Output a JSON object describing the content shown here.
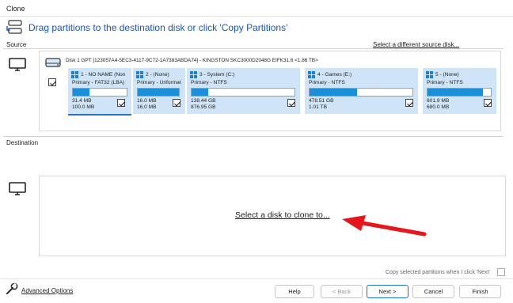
{
  "window": {
    "title": "Clone"
  },
  "heading": "Drag partitions to the destination disk or click 'Copy Partitions'",
  "source": {
    "label": "Source",
    "select_link": "Select a different source disk...",
    "disk_title": "Disk 1 GPT [123057A4-5EC3-4117-9C72-1A7383ABDA74] - KINGSTON SKC3000D2048G EIFK31.6  <1.86 TB>",
    "disk_checked": true,
    "partitions": [
      {
        "name": "1 - NO NAME (Non",
        "type": "Primary - FAT32 (LBA)",
        "used": "31.4 MB",
        "total": "100.0 MB",
        "fill": 0.31,
        "checked": true,
        "os_icon": "windows-icon"
      },
      {
        "name": "2 -  (None)",
        "type": "Primary - Unformat",
        "used": "16.0 MB",
        "total": "16.0 MB",
        "fill": 1.0,
        "checked": true,
        "os_icon": "windows-icon"
      },
      {
        "name": "3 - System (C:)",
        "type": "Primary - NTFS",
        "used": "138.44 GB",
        "total": "876.95 GB",
        "fill": 0.16,
        "checked": true,
        "os_icon": "windows-icon"
      },
      {
        "name": "4 - Games (E:)",
        "type": "Primary - NTFS",
        "used": "478.51 GB",
        "total": "1.01 TB",
        "fill": 0.46,
        "checked": true,
        "os_icon": "windows-icon"
      },
      {
        "name": "5 -  (None)",
        "type": "Primary - NTFS",
        "used": "601.9 MB",
        "total": "680.0 MB",
        "fill": 0.88,
        "checked": true,
        "os_icon": "windows-icon"
      }
    ]
  },
  "destination": {
    "label": "Destination",
    "select_link": "Select a disk to clone to..."
  },
  "copy_selected": {
    "label": "Copy selected partitions when I click 'Next'",
    "checked": false
  },
  "footer": {
    "advanced_label": "Advanced Options",
    "help_label": "Help",
    "back_label": "< Back",
    "next_label": "Next >",
    "cancel_label": "Cancel",
    "finish_label": "Finish"
  },
  "colors": {
    "heading": "#1a57b8",
    "partition_bg": "#cfe5f7",
    "bar_fill": "#1b8fd8",
    "arrow": "#e8161c",
    "primary_border": "#1a73c7"
  }
}
